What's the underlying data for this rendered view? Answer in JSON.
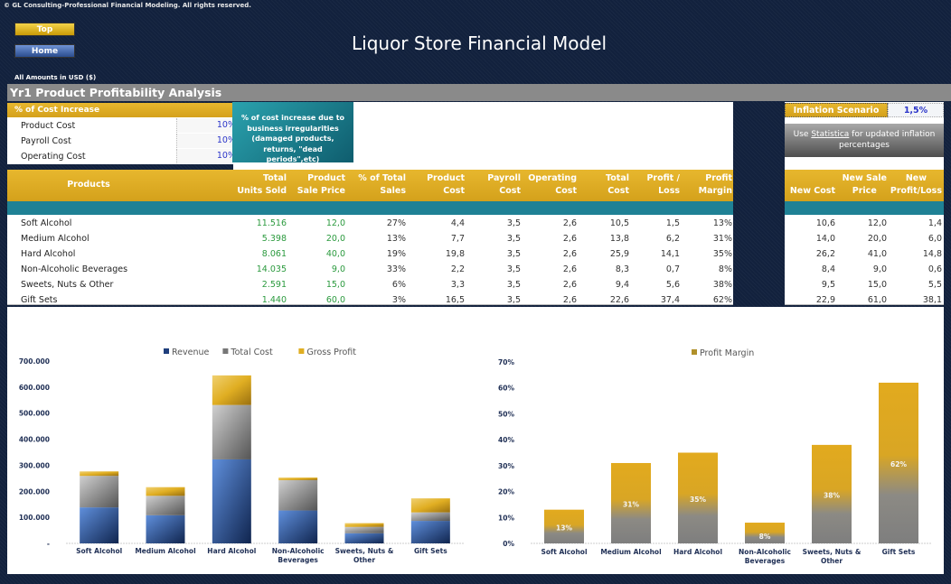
{
  "copyright": "© GL Consulting-Professional Financial Modeling. All rights reserved.",
  "nav": {
    "top_label": "Top",
    "home_label": "Home"
  },
  "title": "Liquor Store Financial Model",
  "amounts_note": "All Amounts in  USD ($)",
  "section_title": "Yr1 Product Profitability Analysis",
  "cost_increase": {
    "header": "% of Cost Increase",
    "rows": [
      {
        "label": "Product Cost",
        "value": "10%"
      },
      {
        "label": "Payroll Cost",
        "value": "10%"
      },
      {
        "label": "Operating Cost",
        "value": "10%"
      }
    ],
    "note": "% of cost increase due to business irregularities (damaged products, returns, \"dead periods\",etc)"
  },
  "inflation": {
    "label": "Inflation Scenario",
    "value": "1,5%",
    "hint_prefix": "Use ",
    "hint_link": "Statistica",
    "hint_suffix": " for updated inflation percentages"
  },
  "table": {
    "headers": [
      "Products",
      "Total Units Sold",
      "Product Sale Price",
      "% of Total Sales",
      "Product Cost",
      "Payroll Cost",
      "Operating Cost",
      "Total Cost",
      "Profit / Loss",
      "Profit Margin"
    ],
    "headers_lines": [
      [
        "Products",
        ""
      ],
      [
        "Total",
        "Units Sold"
      ],
      [
        "Product",
        "Sale Price"
      ],
      [
        "% of Total",
        "Sales"
      ],
      [
        "Product",
        "Cost"
      ],
      [
        "Payroll",
        "Cost"
      ],
      [
        "Operating",
        "Cost"
      ],
      [
        "Total",
        "Cost"
      ],
      [
        "Profit /",
        "Loss"
      ],
      [
        "Profit",
        "Margin"
      ]
    ],
    "rows": [
      [
        "Soft Alcohol",
        "11.516",
        "12,0",
        "27%",
        "4,4",
        "3,5",
        "2,6",
        "10,5",
        "1,5",
        "13%"
      ],
      [
        "Medium Alcohol",
        "5.398",
        "20,0",
        "13%",
        "7,7",
        "3,5",
        "2,6",
        "13,8",
        "6,2",
        "31%"
      ],
      [
        "Hard Alcohol",
        "8.061",
        "40,0",
        "19%",
        "19,8",
        "3,5",
        "2,6",
        "25,9",
        "14,1",
        "35%"
      ],
      [
        "Non-Alcoholic Beverages",
        "14.035",
        "9,0",
        "33%",
        "2,2",
        "3,5",
        "2,6",
        "8,3",
        "0,7",
        "8%"
      ],
      [
        "Sweets, Nuts & Other",
        "2.591",
        "15,0",
        "6%",
        "3,3",
        "3,5",
        "2,6",
        "9,4",
        "5,6",
        "38%"
      ],
      [
        "Gift Sets",
        "1.440",
        "60,0",
        "3%",
        "16,5",
        "3,5",
        "2,6",
        "22,6",
        "37,4",
        "62%"
      ]
    ]
  },
  "inflation_table": {
    "headers_lines": [
      [
        "",
        "New Cost"
      ],
      [
        "New Sale",
        "Price"
      ],
      [
        "New",
        "Profit/Loss"
      ]
    ],
    "rows": [
      [
        "10,6",
        "12,0",
        "1,4"
      ],
      [
        "14,0",
        "20,0",
        "6,0"
      ],
      [
        "26,2",
        "41,0",
        "14,8"
      ],
      [
        "8,4",
        "9,0",
        "0,6"
      ],
      [
        "9,5",
        "15,0",
        "5,5"
      ],
      [
        "22,9",
        "61,0",
        "38,1"
      ]
    ]
  },
  "colors": {
    "background": "#12213d",
    "gold": "#e0ad20",
    "teal": "#1f8195",
    "revenue": "#2d5aa8",
    "total_cost": "#8c8c8c",
    "gross_profit": "#e2b124",
    "input_blue": "#2b35c9",
    "green_value": "#2b9a3e"
  },
  "chart_data": [
    {
      "type": "bar",
      "stacked": true,
      "title": "",
      "categories": [
        "Soft Alcohol",
        "Medium Alcohol",
        "Hard Alcohol",
        "Non-Alcoholic Beverages",
        "Sweets, Nuts & Other",
        "Gift Sets"
      ],
      "category_lines": [
        [
          "Soft Alcohol"
        ],
        [
          "Medium Alcohol"
        ],
        [
          "Hard Alcohol"
        ],
        [
          "Non-Alcoholic",
          "Beverages"
        ],
        [
          "Sweets, Nuts &",
          "Other"
        ],
        [
          "Gift Sets"
        ]
      ],
      "series": [
        {
          "name": "Revenue",
          "values": [
            138192,
            107960,
            322440,
            126315,
            38865,
            86400
          ]
        },
        {
          "name": "Total Cost",
          "values": [
            120918,
            74492,
            208780,
            116491,
            24355,
            32544
          ]
        },
        {
          "name": "Gross Profit",
          "values": [
            17274,
            33468,
            113660,
            9824,
            14510,
            53856
          ]
        }
      ],
      "ylim": [
        0,
        700000
      ],
      "yticks": [
        0,
        100000,
        200000,
        300000,
        400000,
        500000,
        600000,
        700000
      ],
      "ytick_labels": [
        "-",
        "100.000",
        "200.000",
        "300.000",
        "400.000",
        "500.000",
        "600.000",
        "700.000"
      ],
      "legend": "top-center",
      "grid": false,
      "xlabel": "",
      "ylabel": ""
    },
    {
      "type": "bar",
      "title": "",
      "categories": [
        "Soft Alcohol",
        "Medium Alcohol",
        "Hard Alcohol",
        "Non-Alcoholic Beverages",
        "Sweets, Nuts & Other",
        "Gift Sets"
      ],
      "category_lines": [
        [
          "Soft Alcohol"
        ],
        [
          "Medium Alcohol"
        ],
        [
          "Hard Alcohol"
        ],
        [
          "Non-Alcoholic",
          "Beverages"
        ],
        [
          "Sweets, Nuts &",
          "Other"
        ],
        [
          "Gift Sets"
        ]
      ],
      "series": [
        {
          "name": "Profit Margin",
          "values": [
            13,
            31,
            35,
            8,
            38,
            62
          ]
        }
      ],
      "data_labels": [
        "13%",
        "31%",
        "35%",
        "8%",
        "38%",
        "62%"
      ],
      "ylim": [
        0,
        70
      ],
      "yticks": [
        0,
        10,
        20,
        30,
        40,
        50,
        60,
        70
      ],
      "ytick_labels": [
        "0%",
        "10%",
        "20%",
        "30%",
        "40%",
        "50%",
        "60%",
        "70%"
      ],
      "legend": "top-center",
      "grid": false,
      "xlabel": "",
      "ylabel": ""
    }
  ]
}
